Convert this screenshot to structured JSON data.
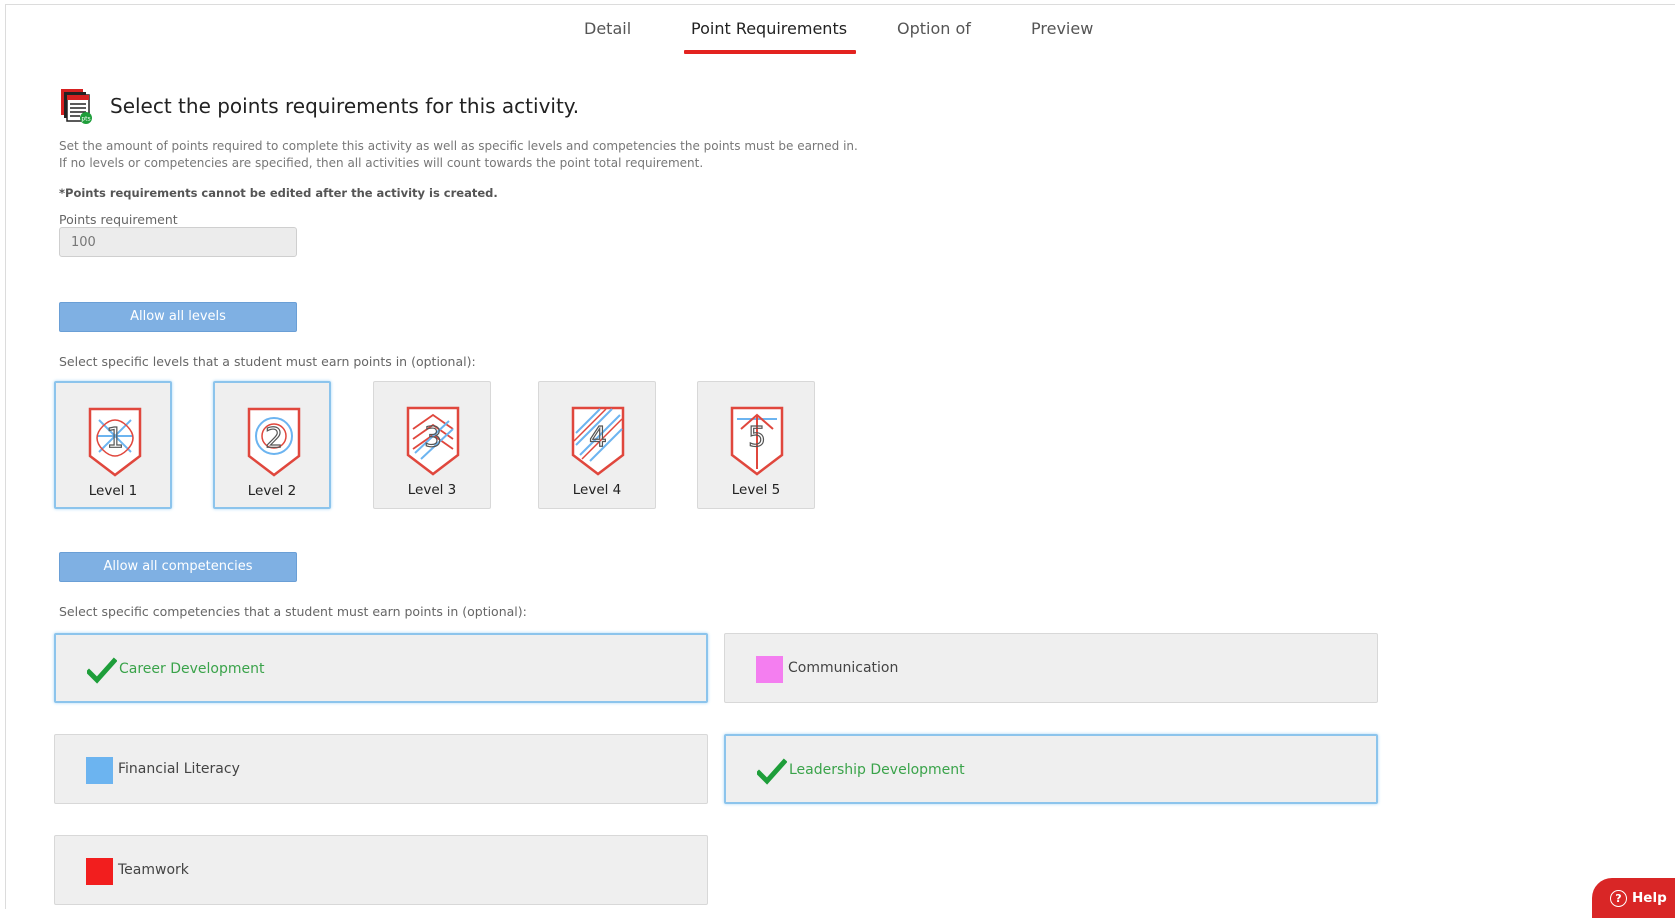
{
  "tabs": [
    {
      "label": "Detail"
    },
    {
      "label": "Point Requirements",
      "active": true
    },
    {
      "label": "Option of"
    },
    {
      "label": "Preview"
    }
  ],
  "header": {
    "icon": "points-stack-icon",
    "title": "Select the points requirements for this activity."
  },
  "description": {
    "line1": "Set the amount of points required to complete this activity as well as specific levels and competencies the points must be earned in.",
    "line2": "If no levels or competencies are specified, then all activities will count towards the point total requirement.",
    "note": "*Points requirements cannot be edited after the activity is created."
  },
  "points": {
    "label": "Points requirement",
    "value": "100"
  },
  "levels": {
    "allow_all_label": "Allow all levels",
    "prompt": "Select specific levels that a student must earn points in (optional):",
    "items": [
      {
        "label": "Level 1",
        "number": "1",
        "selected": true
      },
      {
        "label": "Level 2",
        "number": "2",
        "selected": true
      },
      {
        "label": "Level 3",
        "number": "3",
        "selected": false
      },
      {
        "label": "Level 4",
        "number": "4",
        "selected": false
      },
      {
        "label": "Level 5",
        "number": "5",
        "selected": false
      }
    ]
  },
  "competencies": {
    "allow_all_label": "Allow all competencies",
    "prompt": "Select specific competencies that a student must earn points in (optional):",
    "items": [
      {
        "label": "Career Development",
        "selected": true,
        "color": "#3aa34a"
      },
      {
        "label": "Communication",
        "selected": false,
        "color": "#f47ef0"
      },
      {
        "label": "Financial Literacy",
        "selected": false,
        "color": "#6cb4f0"
      },
      {
        "label": "Leadership Development",
        "selected": true,
        "color": "#3aa34a"
      },
      {
        "label": "Teamwork",
        "selected": false,
        "color": "#f21e1e"
      }
    ]
  },
  "colors": {
    "accent_red": "#e32320",
    "button_blue": "#7fb0e3",
    "selected_border": "#8cc4ec",
    "check_green": "#1e9e3a"
  },
  "help": {
    "label": "Help",
    "icon": "question-circle-icon"
  }
}
